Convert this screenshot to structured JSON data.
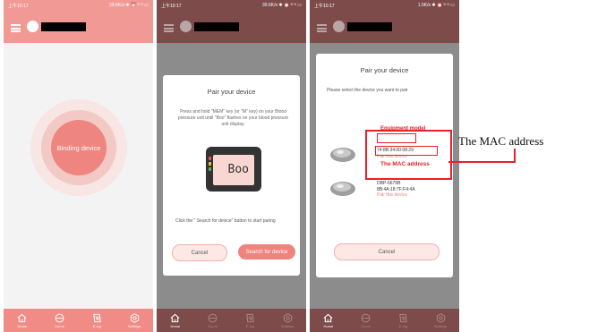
{
  "panel1": {
    "status": {
      "time": "上午10:17",
      "net": "39.6K/s ✱ ⏰ ⁱˡˡ ⁱˡˡ ▭"
    },
    "bind_button": "Binding device"
  },
  "panel2": {
    "status": {
      "time": "上午10:17",
      "net": "39.6K/s ✱ ⏰ ⁱˡˡ ⁱˡˡ ▭"
    },
    "dialog": {
      "title": "Pair your device",
      "instructions": "Press and hold \"MEM\" key (or \"M\" key) on your Blood pressure unit until \"Boo\" flashes on your blood pressure unit display.",
      "device_display": "Boo",
      "click_text": "Click the \" Search for device\" button to start paring",
      "cancel": "Cancel",
      "search": "Search for device"
    }
  },
  "panel3": {
    "status": {
      "time": "上午10:17",
      "net": "1.5K/s ✱ ⏰ ⁱˡˡ ⁱˡˡ ▭"
    },
    "dialog": {
      "title": "Pair your device",
      "subtitle": "Please select the device you want to pair",
      "devices": [
        {
          "model": "",
          "mac": "74:8B:34:00:08:29",
          "action": "Pair this device"
        },
        {
          "model": "DBP-6679B",
          "mac": "8B:4A:18:7F:F4:4A",
          "action": "Pair this device"
        }
      ],
      "annotation_model": "Equipment model",
      "annotation_mac": "The MAC address",
      "cancel": "Cancel"
    }
  },
  "nav": [
    {
      "label": "Home",
      "icon": "home-icon"
    },
    {
      "label": "Curve",
      "icon": "curve-icon"
    },
    {
      "label": "E-log",
      "icon": "elog-icon"
    },
    {
      "label": "Settings",
      "icon": "settings-icon"
    }
  ],
  "callout": {
    "label": "The MAC address"
  },
  "colors": {
    "accent": "#ef837d",
    "annotation_red": "#e8202a",
    "overlay_bar": "#7d4c4a"
  }
}
